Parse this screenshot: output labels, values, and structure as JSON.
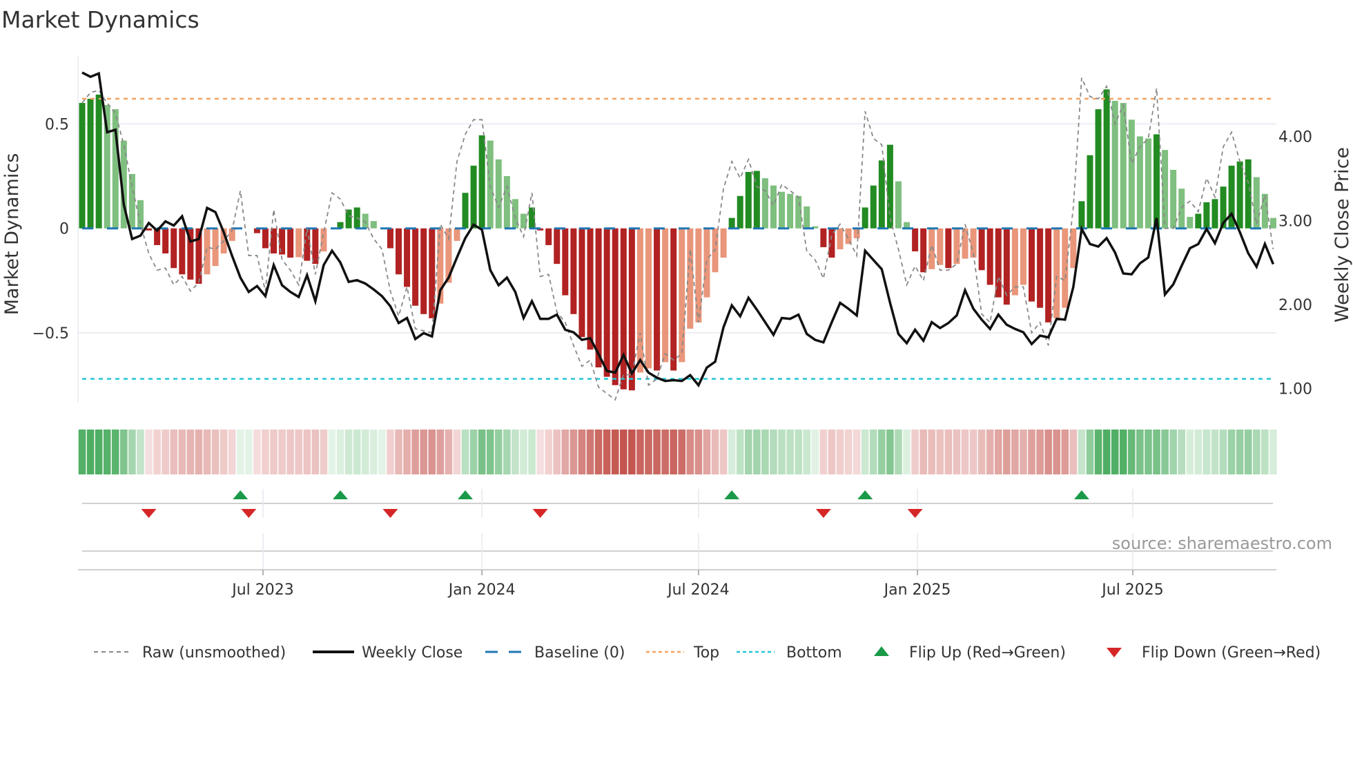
{
  "chart_data": {
    "type": "bar",
    "title": "Market Dynamics",
    "ylabel": "Market Dynamics",
    "ylabel_right": "Weekly Close Price",
    "ylim": [
      -0.84,
      0.83
    ],
    "ylim_right": [
      1.0,
      4.0
    ],
    "left_ticks": [
      {
        "value": 0.5,
        "label": "0.5"
      },
      {
        "value": 0,
        "label": "0"
      },
      {
        "value": -0.5,
        "label": "−0.5"
      }
    ],
    "right_ticks": [
      {
        "value": 4,
        "label": "4.00"
      },
      {
        "value": 3,
        "label": "3.00"
      },
      {
        "value": 2,
        "label": "2.00"
      },
      {
        "value": 1,
        "label": "1.00"
      }
    ],
    "x_start": "2023-01-30",
    "x_step_days": 7,
    "x_ticks": [
      {
        "date": "2023-07-01",
        "label": "Jul 2023"
      },
      {
        "date": "2024-01-01",
        "label": "Jan 2024"
      },
      {
        "date": "2024-07-01",
        "label": "Jul 2024"
      },
      {
        "date": "2025-01-01",
        "label": "Jan 2025"
      },
      {
        "date": "2025-07-01",
        "label": "Jul 2025"
      }
    ],
    "top_level": 0.62,
    "bottom_level": -0.72,
    "baseline": 0,
    "momentum": [
      0.6,
      0.62,
      0.64,
      0.59,
      0.57,
      0.42,
      0.26,
      0.135,
      -0.01,
      -0.08,
      -0.12,
      -0.19,
      -0.22,
      -0.245,
      -0.265,
      -0.22,
      -0.18,
      -0.12,
      -0.06,
      0,
      0,
      -0.023,
      -0.095,
      -0.12,
      -0.125,
      -0.14,
      -0.138,
      -0.155,
      -0.17,
      -0.11,
      0,
      0.03,
      0.09,
      0.1,
      0.07,
      0.035,
      0,
      -0.095,
      -0.22,
      -0.28,
      -0.37,
      -0.41,
      -0.43,
      -0.36,
      -0.26,
      -0.06,
      0.17,
      0.3,
      0.445,
      0.42,
      0.33,
      0.25,
      0.14,
      0.07,
      0.1,
      -0.01,
      -0.08,
      -0.17,
      -0.32,
      -0.41,
      -0.52,
      -0.58,
      -0.665,
      -0.71,
      -0.75,
      -0.77,
      -0.775,
      -0.69,
      -0.67,
      -0.68,
      -0.64,
      -0.68,
      -0.64,
      -0.48,
      -0.45,
      -0.33,
      -0.21,
      -0.14,
      0.05,
      0.155,
      0.27,
      0.275,
      0.24,
      0.205,
      0.175,
      0.165,
      0.155,
      0.105,
      0.01,
      -0.09,
      -0.14,
      -0.1,
      -0.075,
      -0.047,
      0.1,
      0.205,
      0.325,
      0.4,
      0.225,
      0.03,
      -0.11,
      -0.21,
      -0.195,
      -0.175,
      -0.19,
      -0.17,
      -0.145,
      -0.14,
      -0.2,
      -0.27,
      -0.33,
      -0.365,
      -0.32,
      -0.27,
      -0.35,
      -0.38,
      -0.45,
      -0.43,
      -0.38,
      -0.19,
      0.13,
      0.35,
      0.57,
      0.665,
      0.61,
      0.6,
      0.52,
      0.44,
      0.43,
      0.45,
      0.375,
      0.28,
      0.19,
      0.055,
      0.07,
      0.125,
      0.14,
      0.2,
      0.3,
      0.32,
      0.33,
      0.245,
      0.165,
      0.05
    ],
    "raw": [
      0.6,
      0.65,
      0.66,
      0.6,
      0.55,
      0.4,
      0.2,
      0.02,
      -0.12,
      -0.2,
      -0.19,
      -0.27,
      -0.23,
      -0.3,
      -0.26,
      -0.09,
      -0.1,
      -0.06,
      -0.01,
      0.18,
      -0.13,
      -0.13,
      -0.3,
      0.09,
      -0.15,
      -0.2,
      -0.27,
      0.0,
      -0.22,
      -0.02,
      0.17,
      0.14,
      0.06,
      0.05,
      0.03,
      -0.05,
      -0.1,
      -0.3,
      -0.42,
      -0.28,
      -0.48,
      -0.49,
      -0.5,
      0.02,
      -0.05,
      0.32,
      0.45,
      0.52,
      0.52,
      0.2,
      0.1,
      0.2,
      0.05,
      -0.04,
      0.17,
      -0.23,
      -0.22,
      -0.4,
      -0.45,
      -0.56,
      -0.66,
      -0.63,
      -0.76,
      -0.79,
      -0.82,
      -0.7,
      -0.7,
      -0.5,
      -0.75,
      -0.72,
      -0.6,
      -0.63,
      -0.6,
      -0.1,
      -0.45,
      -0.15,
      -0.1,
      0.19,
      0.32,
      0.24,
      0.33,
      0.2,
      0.18,
      0.11,
      0.21,
      0.18,
      0.15,
      -0.11,
      -0.15,
      -0.24,
      -0.03,
      0.02,
      -0.05,
      -0.13,
      0.56,
      0.43,
      0.4,
      0.05,
      -0.1,
      -0.27,
      -0.18,
      -0.25,
      -0.08,
      -0.2,
      -0.2,
      -0.17,
      0.02,
      -0.12,
      -0.41,
      -0.45,
      -0.23,
      -0.32,
      -0.28,
      -0.28,
      -0.5,
      -0.45,
      -0.56,
      -0.23,
      -0.25,
      0.1,
      0.72,
      0.63,
      0.62,
      0.68,
      0.5,
      0.59,
      0.31,
      0.39,
      0.43,
      0.67,
      0.0,
      0.0,
      0.1,
      0.13,
      0.08,
      0.24,
      0.15,
      0.39,
      0.46,
      0.32,
      0.22,
      0.02,
      0.16,
      -0.1
    ],
    "close": [
      4.76,
      4.71,
      4.75,
      4.05,
      4.08,
      3.19,
      2.78,
      2.82,
      2.97,
      2.88,
      2.99,
      2.94,
      3.05,
      2.75,
      2.78,
      3.15,
      3.1,
      2.86,
      2.58,
      2.32,
      2.15,
      2.22,
      2.1,
      2.47,
      2.23,
      2.15,
      2.09,
      2.35,
      2.04,
      2.47,
      2.64,
      2.5,
      2.27,
      2.29,
      2.25,
      2.18,
      2.1,
      1.98,
      1.78,
      1.84,
      1.59,
      1.66,
      1.62,
      2.17,
      2.32,
      2.56,
      2.79,
      2.95,
      2.89,
      2.41,
      2.23,
      2.32,
      2.15,
      1.84,
      2.04,
      1.83,
      1.83,
      1.88,
      1.7,
      1.67,
      1.58,
      1.6,
      1.41,
      1.21,
      1.19,
      1.4,
      1.18,
      1.34,
      1.19,
      1.13,
      1.09,
      1.1,
      1.09,
      1.16,
      1.04,
      1.25,
      1.32,
      1.73,
      1.99,
      1.86,
      2.08,
      1.94,
      1.79,
      1.64,
      1.84,
      1.83,
      1.88,
      1.65,
      1.58,
      1.55,
      1.79,
      2.02,
      1.95,
      1.87,
      2.64,
      2.53,
      2.42,
      2.02,
      1.65,
      1.54,
      1.7,
      1.57,
      1.79,
      1.72,
      1.78,
      1.87,
      2.17,
      1.95,
      1.82,
      1.71,
      1.88,
      1.76,
      1.71,
      1.67,
      1.53,
      1.63,
      1.61,
      1.83,
      1.82,
      2.21,
      2.9,
      2.72,
      2.69,
      2.79,
      2.62,
      2.37,
      2.36,
      2.49,
      2.56,
      3.03,
      2.12,
      2.24,
      2.46,
      2.67,
      2.72,
      2.9,
      2.73,
      2.97,
      3.08,
      2.86,
      2.61,
      2.45,
      2.72,
      2.48
    ],
    "flip_up_weeks": [
      19,
      31,
      46,
      78,
      94,
      120
    ],
    "flip_down_weeks": [
      8,
      20,
      37,
      55,
      89,
      100
    ],
    "legend": [
      {
        "label": "Raw (unsmoothed)",
        "kind": "raw"
      },
      {
        "label": "Weekly Close",
        "kind": "close"
      },
      {
        "label": "Baseline (0)",
        "kind": "baseline"
      },
      {
        "label": "Top",
        "kind": "top"
      },
      {
        "label": "Bottom",
        "kind": "bottom"
      },
      {
        "label": "Flip Up (Red→Green)",
        "kind": "up"
      },
      {
        "label": "Flip Down (Green→Red)",
        "kind": "down"
      }
    ],
    "legend_position": "bottom",
    "source": "source: sharemaestro.com"
  },
  "colors": {
    "strong_green": "#228b22",
    "weak_green": "#7fbf7f",
    "strong_red": "#b22222",
    "weak_red": "#e9967a",
    "close": "#111111",
    "raw": "#888888",
    "baseline": "#1f77b4",
    "top": "#f4a261",
    "bottom": "#22c5d8",
    "flip_up": "#1a9a48",
    "flip_down": "#d62728"
  }
}
